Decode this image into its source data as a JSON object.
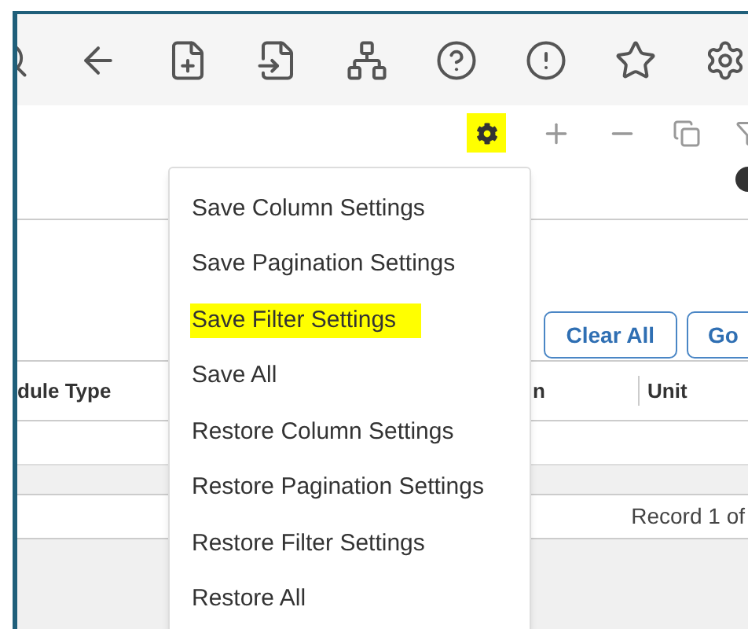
{
  "grid_toolbar": {
    "settings_highlighted": true
  },
  "menu": {
    "items": [
      {
        "label": "Save Column Settings",
        "highlighted": false
      },
      {
        "label": "Save Pagination Settings",
        "highlighted": false
      },
      {
        "label": "Save Filter Settings",
        "highlighted": true
      },
      {
        "label": "Save All",
        "highlighted": false
      },
      {
        "label": "Restore Column Settings",
        "highlighted": false
      },
      {
        "label": "Restore Pagination Settings",
        "highlighted": false
      },
      {
        "label": "Restore Filter Settings",
        "highlighted": false
      },
      {
        "label": "Restore All",
        "highlighted": false
      }
    ]
  },
  "buttons": [
    "Clear All",
    "Go"
  ],
  "table": {
    "columns": [
      "dule Type",
      "n",
      "Unit"
    ]
  },
  "pager": {
    "text": "Record 1 of"
  }
}
